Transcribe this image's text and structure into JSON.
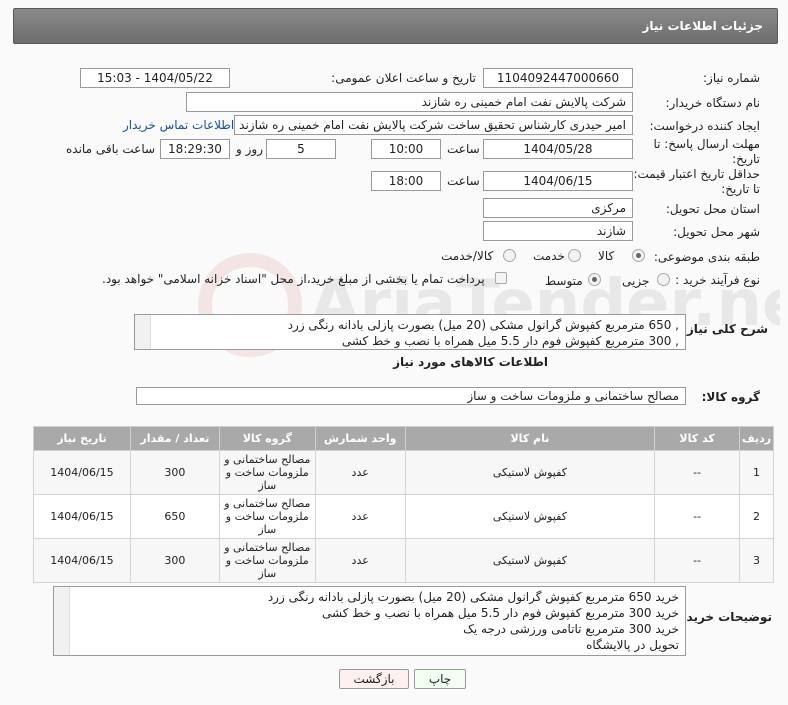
{
  "header": {
    "title": "جزئیات اطلاعات نیاز"
  },
  "fields": {
    "need_number_label": "شماره نیاز:",
    "need_number": "1104092447000660",
    "announce_label": "تاریخ و ساعت اعلان عمومی:",
    "announce_value": "1404/05/22 - 15:03",
    "buyer_label": "نام دستگاه خریدار:",
    "buyer_value": "شرکت پالایش نفت امام خمینی  ره  شازند",
    "creator_label": "ایجاد کننده درخواست:",
    "creator_value": "امیر  حیدری کارشناس تحقیق ساخت شرکت پالایش نفت امام خمینی  ره  شازند",
    "contact_link": "اطلاعات تماس خریدار",
    "deadline_label_1": "مهلت ارسال پاسخ: تا",
    "deadline_label_2": "تاریخ:",
    "deadline_date": "1404/05/28",
    "time_label": "ساعت",
    "deadline_time": "10:00",
    "days_value": "5",
    "days_label": "روز و",
    "remaining_time": "18:29:30",
    "remaining_label": "ساعت باقی مانده",
    "min_price_label_1": "حداقل تاریخ اعتبار قیمت:",
    "min_price_label_2": "تا تاریخ:",
    "min_price_date": "1404/06/15",
    "min_price_time": "18:00",
    "province_label": "استان محل تحویل:",
    "province_value": "مرکزی",
    "city_label": "شهر محل تحویل:",
    "city_value": "شازند",
    "category_label": "طبقه بندی موضوعی:",
    "category_options": [
      "کالا",
      "خدمت",
      "کالا/خدمت"
    ],
    "process_label": "نوع فرآیند خرید :",
    "process_options": [
      "جزیی",
      "متوسط"
    ],
    "payment_note": "پرداخت تمام یا بخشی از مبلغ خرید،از محل \"اسناد خزانه اسلامی\" خواهد بود.",
    "summary_label": "شرح کلی نیاز:",
    "summary_lines": [
      ", 650 مترمربع کفپوش گرانول مشکی (20 میل) بصورت پازلی بادانه رنگی زرد",
      ", 300 مترمربع کفپوش فوم دار 5.5 میل همراه با نصب و خط کشی"
    ],
    "goods_info_title": "اطلاعات کالاهای مورد نیاز",
    "goods_group_label": "گروه کالا:",
    "goods_group_value": "مصالح ساختمانی و ملزومات ساخت و ساز"
  },
  "table": {
    "headers": [
      "ردیف",
      "کد کالا",
      "نام کالا",
      "واحد شمارش",
      "گروه کالا",
      "تعداد / مقدار",
      "تاریخ نیاز"
    ],
    "rows": [
      [
        "1",
        "--",
        "کفپوش لاستیکی",
        "عدد",
        "مصالح ساختمانی و ملزومات ساخت و ساز",
        "300",
        "1404/06/15"
      ],
      [
        "2",
        "--",
        "کفپوش لاستیکی",
        "عدد",
        "مصالح ساختمانی و ملزومات ساخت و ساز",
        "650",
        "1404/06/15"
      ],
      [
        "3",
        "--",
        "کفپوش لاستیکی",
        "عدد",
        "مصالح ساختمانی و ملزومات ساخت و ساز",
        "300",
        "1404/06/15"
      ]
    ]
  },
  "buyer_notes": {
    "label": "توضیحات خریدار:",
    "lines": [
      "خرید 650 مترمربع کفپوش گرانول مشکی (20 میل) بصورت پازلی بادانه رنگی زرد",
      "خرید 300 مترمربع کفپوش فوم دار 5.5 میل همراه با نصب و خط کشی",
      "خرید 300 مترمربع تاتامی ورزشی درجه یک",
      "تحویل در پالایشگاه"
    ]
  },
  "buttons": {
    "print": "چاپ",
    "back": "بازگشت"
  },
  "watermark": {
    "text": "AriaTender.neT"
  }
}
